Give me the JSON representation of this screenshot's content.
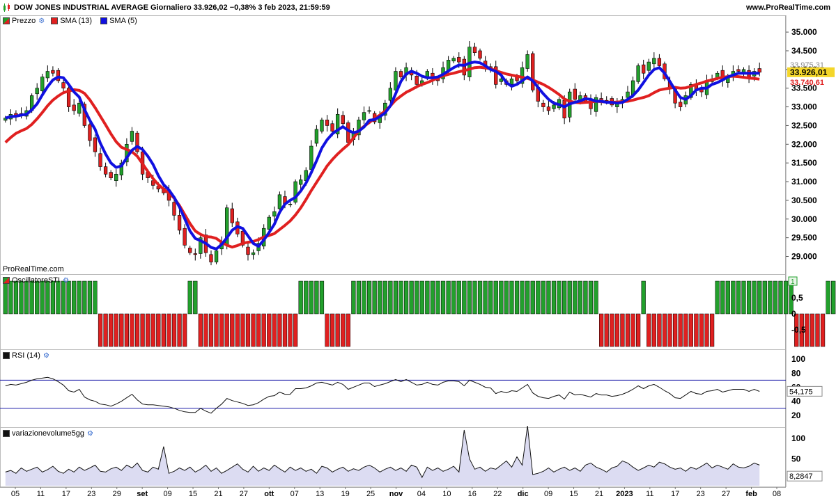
{
  "header": {
    "title": "DOW JONES INDUSTRIAL AVERAGE Giornaliero 33.926,02 −0,38% 3 feb 2023, 21:59:59",
    "brand": "www.ProRealTime.com",
    "watermark": "ProRealTime.com"
  },
  "legends": {
    "price": {
      "label": "Prezzo",
      "up_color": "#22a02c",
      "down_color": "#e02020"
    },
    "sma13": {
      "label": "SMA (13)",
      "color": "#e02020"
    },
    "sma5": {
      "label": "SMA (5)",
      "color": "#1010e0"
    },
    "sti": {
      "label": "OscillatoreSTI"
    },
    "rsi": {
      "label": "RSI (14)"
    },
    "vol": {
      "label": "variazionevolume5gg"
    }
  },
  "chart_data": [
    {
      "type": "candlestick",
      "name": "price",
      "ylim": [
        28600,
        35300
      ],
      "y_ticks": [
        "35.000",
        "34.500",
        "34.000",
        "33.500",
        "33.000",
        "32.500",
        "32.000",
        "31.500",
        "31.000",
        "30.500",
        "30.000",
        "29.500",
        "29.000"
      ],
      "last_price_label": "33.926,01",
      "sma13_label": "33.740,61",
      "hidden_label": "33.975,31",
      "close": [
        32700,
        32800,
        32750,
        32800,
        32900,
        33300,
        33500,
        33800,
        33950,
        33900,
        33700,
        33500,
        33000,
        32900,
        33100,
        32500,
        32100,
        31800,
        31400,
        31200,
        31100,
        31200,
        31500,
        32000,
        32350,
        31800,
        31200,
        31100,
        30900,
        30800,
        30700,
        30500,
        30100,
        29700,
        29300,
        29100,
        29050,
        29500,
        29100,
        28850,
        29150,
        29400,
        30300,
        29900,
        29600,
        29300,
        29050,
        29100,
        29350,
        29750,
        30050,
        30200,
        30650,
        30400,
        30400,
        31000,
        31050,
        31300,
        31950,
        32400,
        32650,
        32500,
        32350,
        32800,
        32550,
        32050,
        32300,
        32650,
        32850,
        32900,
        32600,
        32750,
        33100,
        33500,
        33950,
        33800,
        34050,
        33850,
        33600,
        33700,
        33950,
        33750,
        33700,
        34050,
        34250,
        34300,
        34200,
        33850,
        34600,
        34450,
        34300,
        34100,
        34050,
        33600,
        33750,
        33600,
        33750,
        33700,
        34050,
        34400,
        33450,
        33150,
        33000,
        32900,
        33050,
        33200,
        32700,
        33400,
        33200,
        33300,
        33150,
        32950,
        33250,
        33150,
        33150,
        33050,
        33100,
        33200,
        33400,
        33700,
        34100,
        33900,
        34200,
        34300,
        34100,
        33750,
        33500,
        33100,
        33000,
        33300,
        33600,
        33450,
        33400,
        33700,
        33750,
        33900,
        33700,
        33800,
        33950,
        33950,
        34000,
        33800,
        33950,
        33926
      ],
      "sma13": [
        32050,
        32180,
        32290,
        32360,
        32420,
        32530,
        32680,
        32850,
        33030,
        33180,
        33290,
        33380,
        33420,
        33460,
        33440,
        33360,
        33190,
        32980,
        32750,
        32520,
        32280,
        32070,
        31920,
        31860,
        31800,
        31680,
        31480,
        31270,
        31080,
        30920,
        30800,
        30690,
        30560,
        30360,
        30120,
        29880,
        29680,
        29590,
        29530,
        29520,
        29480,
        29380,
        29300,
        29250,
        29290,
        29350,
        29380,
        29400,
        29450,
        29520,
        29560,
        29610,
        29720,
        29830,
        29950,
        30110,
        30300,
        30520,
        30760,
        30980,
        31200,
        31420,
        31590,
        31740,
        31870,
        31990,
        32170,
        32360,
        32480,
        32580,
        32690,
        32780,
        32890,
        33030,
        33180,
        33290,
        33390,
        33460,
        33540,
        33600,
        33650,
        33710,
        33780,
        33830,
        33870,
        33900,
        33940,
        33970,
        34010,
        34050,
        34060,
        34040,
        34020,
        33970,
        33920,
        33880,
        33850,
        33820,
        33790,
        33760,
        33720,
        33660,
        33600,
        33520,
        33430,
        33330,
        33210,
        33150,
        33120,
        33110,
        33120,
        33130,
        33150,
        33140,
        33130,
        33120,
        33130,
        33140,
        33150,
        33180,
        33220,
        33250,
        33300,
        33380,
        33450,
        33480,
        33500,
        33520,
        33500,
        33510,
        33550,
        33600,
        33640,
        33690,
        33720,
        33760,
        33790,
        33810,
        33820,
        33810,
        33790,
        33770,
        33760,
        33741
      ],
      "sma5": [
        32700,
        32740,
        32750,
        32780,
        32800,
        32920,
        33080,
        33320,
        33540,
        33720,
        33800,
        33780,
        33600,
        33400,
        33260,
        32930,
        32640,
        32400,
        32030,
        31740,
        31500,
        31380,
        31420,
        31640,
        31840,
        31940,
        31860,
        31680,
        31460,
        31160,
        30920,
        30780,
        30580,
        30320,
        30010,
        29680,
        29480,
        29420,
        29350,
        29240,
        29200,
        29320,
        29500,
        29700,
        29800,
        29750,
        29550,
        29350,
        29270,
        29440,
        29640,
        29860,
        30180,
        30400,
        30500,
        30580,
        30750,
        30960,
        31240,
        31560,
        31900,
        32120,
        32280,
        32380,
        32470,
        32370,
        32310,
        32350,
        32460,
        32640,
        32660,
        32740,
        32840,
        33030,
        33350,
        33680,
        33880,
        33950,
        33900,
        33820,
        33780,
        33780,
        33800,
        33870,
        33960,
        34050,
        34120,
        34110,
        34170,
        34200,
        34180,
        34100,
        34000,
        33950,
        33850,
        33650,
        33550,
        33600,
        33700,
        33800,
        33700,
        33520,
        33350,
        33200,
        33100,
        33060,
        33000,
        33080,
        33120,
        33160,
        33220,
        33200,
        33150,
        33150,
        33120,
        33120,
        33100,
        33120,
        33200,
        33300,
        33450,
        33650,
        33850,
        34000,
        34050,
        33900,
        33680,
        33450,
        33250,
        33200,
        33300,
        33450,
        33500,
        33500,
        33600,
        33650,
        33720,
        33800,
        33850,
        33900,
        33900,
        33900,
        33900,
        33900
      ]
    },
    {
      "type": "bar",
      "name": "OscillatoreSTI",
      "ylim": [
        -1.1,
        1.1
      ],
      "y_ticks": [
        "0,5",
        "0",
        "-0,5"
      ],
      "last_label": "1",
      "values": [
        1,
        1,
        1,
        1,
        1,
        1,
        1,
        1,
        1,
        1,
        1,
        1,
        1,
        1,
        1,
        1,
        1,
        1,
        -1,
        -1,
        -1,
        -1,
        -1,
        -1,
        -1,
        -1,
        -1,
        -1,
        -1,
        -1,
        -1,
        -1,
        -1,
        -1,
        -1,
        1,
        1,
        -1,
        -1,
        -1,
        -1,
        -1,
        -1,
        -1,
        -1,
        -1,
        -1,
        -1,
        -1,
        -1,
        -1,
        -1,
        -1,
        -1,
        -1,
        -1,
        1,
        1,
        1,
        1,
        1,
        -1,
        -1,
        -1,
        -1,
        -1,
        1,
        1,
        1,
        1,
        1,
        1,
        1,
        1,
        1,
        1,
        1,
        1,
        1,
        1,
        1,
        1,
        1,
        1,
        1,
        1,
        1,
        1,
        1,
        1,
        1,
        1,
        1,
        1,
        1,
        1,
        1,
        1,
        1,
        1,
        1,
        1,
        1,
        1,
        1,
        1,
        1,
        1,
        1,
        1,
        1,
        1,
        1,
        -1,
        -1,
        -1,
        -1,
        -1,
        -1,
        -1,
        -1,
        1,
        -1,
        -1,
        -1,
        -1,
        -1,
        -1,
        -1,
        -1,
        -1,
        -1,
        -1,
        -1,
        -1,
        1,
        1,
        1,
        1,
        1,
        1,
        1,
        1,
        1,
        1,
        1,
        1,
        1,
        1,
        1,
        -1,
        -1,
        -1,
        -1,
        -1,
        -1,
        1,
        1,
        1,
        1,
        1,
        1,
        1,
        1,
        1
      ]
    },
    {
      "type": "line",
      "name": "RSI (14)",
      "ylim": [
        5,
        110
      ],
      "y_ticks": [
        "100",
        "80",
        "60",
        "40",
        "20"
      ],
      "levels": [
        70,
        30
      ],
      "last_label": "54,175",
      "values": [
        62,
        64,
        63,
        65,
        67,
        70,
        72,
        73,
        74,
        72,
        68,
        63,
        55,
        53,
        57,
        46,
        42,
        40,
        36,
        35,
        33,
        36,
        40,
        45,
        50,
        42,
        36,
        35,
        35,
        34,
        33,
        32,
        30,
        27,
        25,
        24,
        24,
        30,
        26,
        23,
        30,
        36,
        44,
        41,
        39,
        37,
        34,
        35,
        38,
        43,
        47,
        48,
        53,
        50,
        50,
        58,
        58,
        59,
        62,
        66,
        67,
        65,
        63,
        67,
        64,
        57,
        60,
        63,
        66,
        66,
        61,
        63,
        65,
        68,
        71,
        68,
        71,
        67,
        63,
        64,
        67,
        64,
        63,
        67,
        69,
        69,
        68,
        62,
        70,
        67,
        64,
        60,
        59,
        51,
        54,
        52,
        55,
        54,
        59,
        64,
        52,
        47,
        45,
        44,
        47,
        49,
        43,
        53,
        49,
        50,
        48,
        46,
        51,
        49,
        49,
        47,
        48,
        50,
        53,
        57,
        62,
        58,
        62,
        64,
        60,
        55,
        51,
        45,
        44,
        49,
        54,
        51,
        50,
        54,
        55,
        57,
        53,
        55,
        57,
        57,
        57,
        54,
        57,
        54
      ]
    },
    {
      "type": "area",
      "name": "variazionevolume5gg",
      "ylim": [
        -15,
        120
      ],
      "y_ticks": [
        "100",
        "50"
      ],
      "last_label": "8,2847",
      "values": [
        18,
        22,
        15,
        28,
        20,
        25,
        30,
        18,
        24,
        32,
        20,
        15,
        25,
        18,
        30,
        22,
        28,
        35,
        20,
        18,
        26,
        30,
        22,
        35,
        28,
        40,
        22,
        18,
        30,
        25,
        80,
        15,
        20,
        28,
        22,
        30,
        18,
        25,
        35,
        20,
        28,
        15,
        22,
        30,
        38,
        25,
        18,
        32,
        20,
        28,
        22,
        35,
        26,
        18,
        30,
        22,
        28,
        20,
        25,
        15,
        32,
        28,
        18,
        25,
        30,
        20,
        26,
        22,
        30,
        35,
        28,
        18,
        25,
        30,
        22,
        28,
        20,
        35,
        30,
        5,
        30,
        22,
        28,
        20,
        25,
        32,
        18,
        120,
        50,
        25,
        30,
        20,
        28,
        25,
        35,
        45,
        30,
        55,
        35,
        130,
        12,
        15,
        20,
        28,
        18,
        25,
        30,
        22,
        28,
        20,
        35,
        40,
        30,
        25,
        18,
        28,
        32,
        45,
        40,
        30,
        22,
        28,
        35,
        30,
        42,
        38,
        30,
        25,
        28,
        20,
        30,
        25,
        32,
        40,
        28,
        35,
        30,
        25,
        38,
        30,
        28,
        32,
        40,
        35
      ]
    }
  ],
  "x_axis": {
    "labels": [
      "05",
      "11",
      "17",
      "23",
      "29",
      "set",
      "09",
      "15",
      "21",
      "27",
      "ott",
      "07",
      "13",
      "19",
      "25",
      "nov",
      "04",
      "10",
      "16",
      "22",
      "dic",
      "09",
      "15",
      "21",
      "2023",
      "11",
      "17",
      "23",
      "27",
      "feb",
      "08"
    ],
    "bold": [
      "set",
      "ott",
      "nov",
      "dic",
      "2023",
      "feb"
    ]
  }
}
